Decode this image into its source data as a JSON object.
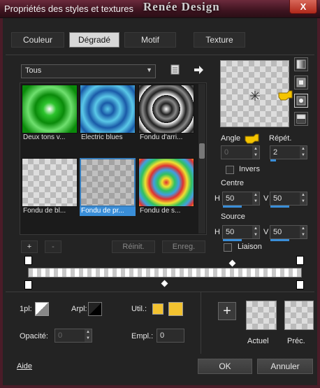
{
  "window": {
    "title": "Propriétés des styles et textures",
    "brand": "Renée Design",
    "close_label": "X"
  },
  "tabs": [
    {
      "label": "Couleur",
      "active": false
    },
    {
      "label": "Dégradé",
      "active": true
    },
    {
      "label": "Motif",
      "active": false
    },
    {
      "label": "Texture",
      "active": false
    }
  ],
  "category_select": {
    "value": "Tous"
  },
  "gallery": {
    "items": [
      {
        "caption": "Deux tons v...",
        "style": "green-radial"
      },
      {
        "caption": "Electric blues",
        "style": "blue-radial"
      },
      {
        "caption": "Fondu d'arri...",
        "style": "black-radial"
      },
      {
        "caption": "Fondu de bl...",
        "style": "checker-white"
      },
      {
        "caption": "Fondu de pr...",
        "style": "checker-fade",
        "selected": true
      },
      {
        "caption": "Fondu de s...",
        "style": "rainbow-radial"
      }
    ]
  },
  "gallery_buttons": {
    "add": "+",
    "remove": "-",
    "reset": "Réinit.",
    "save": "Enreg."
  },
  "angle": {
    "label": "Angle",
    "value": "0"
  },
  "repeat": {
    "label": "Répét.",
    "value": "2"
  },
  "invert": {
    "label": "Invers"
  },
  "centre": {
    "label": "Centre",
    "h_label": "H",
    "h_value": "50",
    "v_label": "V",
    "v_value": "50"
  },
  "source": {
    "label": "Source",
    "h_label": "H",
    "h_value": "50",
    "v_label": "V",
    "v_value": "50"
  },
  "link": {
    "label": "Liaison"
  },
  "bottom": {
    "one_px_label": "1pl:",
    "arpl_label": "Arpl:",
    "util_label": "Util.:",
    "opacity_label": "Opacité:",
    "opacity_value": "0",
    "empl_label": "Empl.:",
    "empl_value": "0",
    "util_color": "#f2c230",
    "add_label": "+",
    "current_label": "Actuel",
    "previous_label": "Préc."
  },
  "footer": {
    "help": "Aide",
    "ok": "OK",
    "cancel": "Annuler"
  }
}
